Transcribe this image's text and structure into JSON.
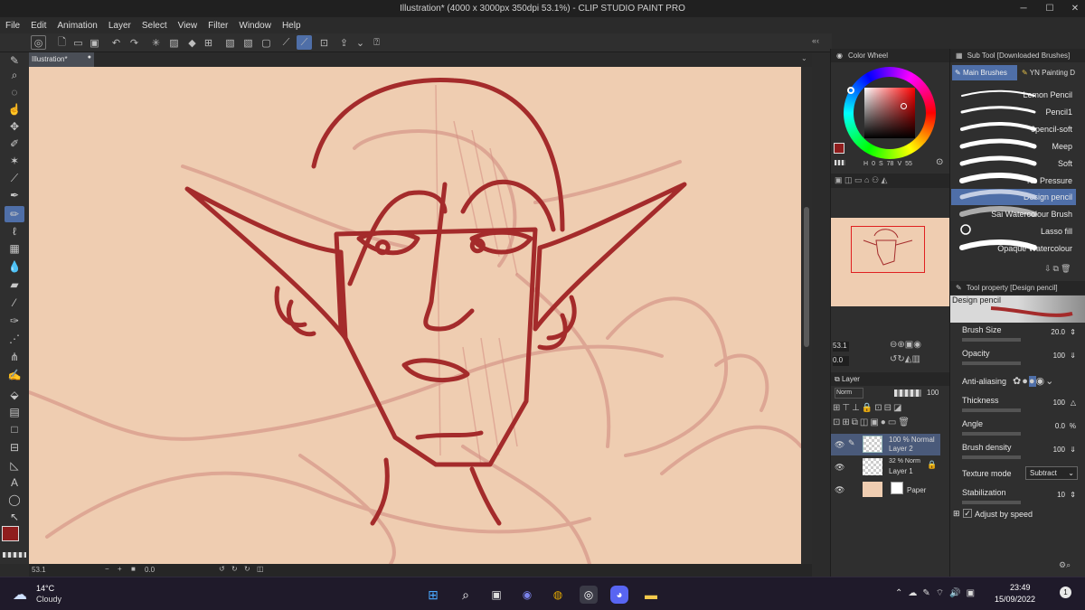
{
  "window": {
    "title": "Illustration* (4000 x 3000px 350dpi 53.1%)  - CLIP STUDIO PAINT PRO",
    "minimize": "─",
    "maximize": "☐",
    "close": "✕"
  },
  "menu": [
    "File",
    "Edit",
    "Animation",
    "Layer",
    "Select",
    "View",
    "Filter",
    "Window",
    "Help"
  ],
  "canvas_tab": {
    "label": "Illustration*"
  },
  "status": {
    "zoom": "53.1",
    "angle": "0.0"
  },
  "colors": {
    "canvas_bg": "#efcdb1",
    "stroke_main": "#a42b2b",
    "stroke_sketch": "#d99a8e",
    "main_color": "#8f1d1d",
    "sub_color": "#ffffff"
  },
  "color_wheel": {
    "title": "Color Wheel",
    "h": "0",
    "s": "78",
    "v": "55",
    "h_label": "H",
    "s_label": "S",
    "v_label": "V"
  },
  "navigator": {
    "zoom": "53.1",
    "angle": "0.0"
  },
  "layer_panel": {
    "title": "Layer",
    "blend_mode": "Norm",
    "opacity": "100",
    "layers": [
      {
        "info": "100 % Normal",
        "name": "Layer 2"
      },
      {
        "info": "32 % Norm",
        "name": "Layer 1"
      },
      {
        "info": "",
        "name": "Paper"
      }
    ]
  },
  "sub_tool": {
    "title": "Sub Tool [Downloaded Brushes]",
    "tabs": [
      "Main Brushes",
      "YN Painting D"
    ],
    "brushes": [
      "Lemon Pencil",
      "Pencil1",
      "6pencil-soft",
      "Meep",
      "Soft",
      "No Pressure",
      "Design pencil",
      "Sai Watercolour Brush",
      "Lasso fill",
      "Opaque Watercolour"
    ]
  },
  "tool_property": {
    "title": "Tool property [Design pencil]",
    "tool_name": "Design pencil",
    "brush_size_label": "Brush Size",
    "brush_size": "20.0",
    "opacity_label": "Opacity",
    "opacity": "100",
    "antialias_label": "Anti-aliasing",
    "thickness_label": "Thickness",
    "thickness": "100",
    "angle_label": "Angle",
    "angle": "0.0",
    "density_label": "Brush density",
    "density": "100",
    "texture_label": "Texture mode",
    "texture": "Subtract",
    "stabilization_label": "Stabilization",
    "stabilization": "10",
    "adjust_label": "Adjust by speed"
  },
  "taskbar": {
    "temp": "14°C",
    "weather": "Cloudy",
    "time": "23:49",
    "date": "15/09/2022",
    "notifications": "1"
  },
  "icons": [
    "zoom-icon",
    "move-icon",
    "operation-icon",
    "eyedropper-icon",
    "pen-icon",
    "pencil-icon",
    "brush-icon",
    "eraser-icon",
    "fill-icon",
    "gradient-icon",
    "text-icon",
    "lasso-icon"
  ]
}
